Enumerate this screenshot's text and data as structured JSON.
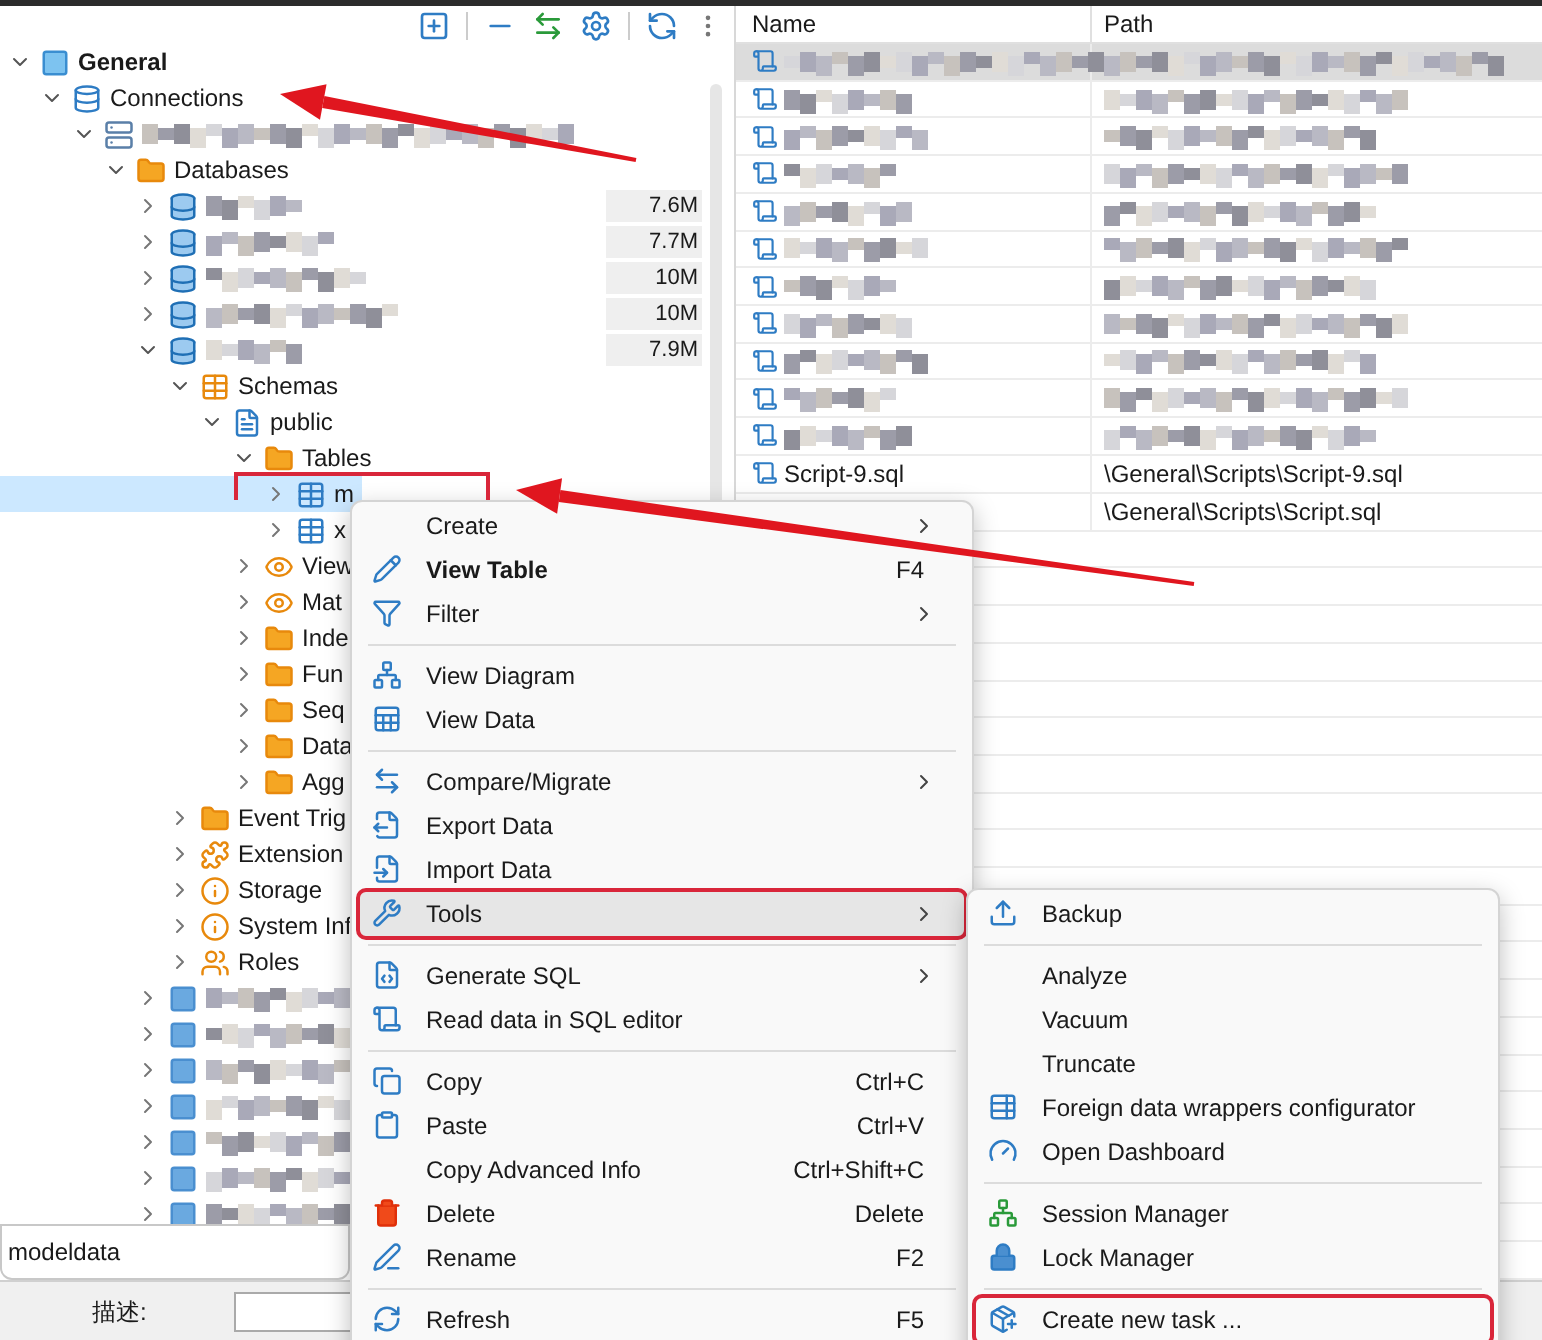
{
  "navigator": {
    "tree": [
      {
        "label": "General",
        "kind": "project",
        "expanded": true,
        "selected": false,
        "children": [
          {
            "label": "Connections",
            "kind": "connections",
            "expanded": true,
            "selected": false,
            "children": [
              {
                "kind": "connection",
                "expanded": true,
                "selected": false,
                "children": [
                  {
                    "label": "Databases",
                    "kind": "folder",
                    "expanded": true,
                    "selected": false,
                    "children": [
                      {
                        "kind": "database",
                        "expanded": false,
                        "selected": false,
                        "size": "7.6M"
                      },
                      {
                        "kind": "database",
                        "expanded": false,
                        "selected": false,
                        "size": "7.7M"
                      },
                      {
                        "kind": "database",
                        "expanded": false,
                        "selected": false,
                        "size": "10M"
                      },
                      {
                        "kind": "database",
                        "expanded": false,
                        "selected": false,
                        "size": "10M"
                      },
                      {
                        "kind": "database",
                        "expanded": true,
                        "selected": false,
                        "size": "7.9M",
                        "children": [
                          {
                            "label": "Schemas",
                            "kind": "schemas",
                            "expanded": true,
                            "selected": false,
                            "children": [
                              {
                                "label": "public",
                                "kind": "schema",
                                "expanded": true,
                                "selected": false,
                                "children": [
                                  {
                                    "label": "Tables",
                                    "kind": "folder",
                                    "expanded": true,
                                    "selected": false,
                                    "children": [
                                      {
                                        "label": "m",
                                        "kind": "table",
                                        "expanded": false,
                                        "selected": true
                                      },
                                      {
                                        "label": "x",
                                        "kind": "table",
                                        "expanded": false,
                                        "selected": false
                                      }
                                    ]
                                  },
                                  {
                                    "label": "View",
                                    "kind": "view",
                                    "expanded": false,
                                    "selected": false
                                  },
                                  {
                                    "label": "Mat",
                                    "kind": "view",
                                    "expanded": false,
                                    "selected": false
                                  },
                                  {
                                    "label": "Inde",
                                    "kind": "folder",
                                    "expanded": false,
                                    "selected": false
                                  },
                                  {
                                    "label": "Fun",
                                    "kind": "folder",
                                    "expanded": false,
                                    "selected": false
                                  },
                                  {
                                    "label": "Seq",
                                    "kind": "folder",
                                    "expanded": false,
                                    "selected": false
                                  },
                                  {
                                    "label": "Data",
                                    "kind": "folder",
                                    "expanded": false,
                                    "selected": false
                                  },
                                  {
                                    "label": "Agg",
                                    "kind": "folder",
                                    "expanded": false,
                                    "selected": false
                                  }
                                ]
                              }
                            ]
                          },
                          {
                            "label": "Event Trig",
                            "kind": "folder",
                            "expanded": false,
                            "selected": false
                          },
                          {
                            "label": "Extension",
                            "kind": "extensions",
                            "expanded": false,
                            "selected": false
                          },
                          {
                            "label": "Storage",
                            "kind": "info",
                            "expanded": false,
                            "selected": false
                          },
                          {
                            "label": "System Inf",
                            "kind": "info",
                            "expanded": false,
                            "selected": false
                          },
                          {
                            "label": "Roles",
                            "kind": "roles",
                            "expanded": false,
                            "selected": false
                          }
                        ]
                      },
                      {
                        "kind": "other",
                        "expanded": false,
                        "selected": false
                      },
                      {
                        "kind": "other",
                        "expanded": false,
                        "selected": false
                      },
                      {
                        "kind": "other",
                        "expanded": false,
                        "selected": false
                      },
                      {
                        "kind": "other",
                        "expanded": false,
                        "selected": false
                      },
                      {
                        "kind": "other",
                        "expanded": false,
                        "selected": false
                      },
                      {
                        "kind": "other",
                        "expanded": false,
                        "selected": false
                      },
                      {
                        "kind": "other",
                        "expanded": false,
                        "selected": false
                      }
                    ]
                  }
                ]
              }
            ]
          }
        ]
      }
    ],
    "tooltip": "modeldata",
    "description_label": "描述:"
  },
  "scripts_table": {
    "columns": [
      "Name",
      "Path"
    ],
    "rows": [
      {
        "selected": true
      },
      {
        "selected": false
      },
      {
        "selected": false
      },
      {
        "selected": false
      },
      {
        "selected": false
      },
      {
        "selected": false
      },
      {
        "selected": false
      },
      {
        "selected": false
      },
      {
        "selected": false
      },
      {
        "selected": false
      },
      {
        "selected": false
      },
      {
        "name": "Script-9.sql",
        "path": "\\General\\Scripts\\Script-9.sql",
        "selected": false
      },
      {
        "path": "\\General\\Scripts\\Script.sql",
        "selected": false
      }
    ]
  },
  "context_menu": {
    "items": [
      {
        "kind": "item",
        "label": "Create",
        "default": false,
        "submenu": true,
        "selected": false
      },
      {
        "kind": "item",
        "label": "View Table",
        "shortcut": "F4",
        "default": true,
        "submenu": false,
        "selected": false
      },
      {
        "kind": "item",
        "label": "Filter",
        "default": false,
        "submenu": true,
        "selected": false
      },
      {
        "kind": "separator"
      },
      {
        "kind": "item",
        "label": "View Diagram",
        "default": false,
        "submenu": false,
        "selected": false
      },
      {
        "kind": "item",
        "label": "View Data",
        "default": false,
        "submenu": false,
        "selected": false
      },
      {
        "kind": "separator"
      },
      {
        "kind": "item",
        "label": "Compare/Migrate",
        "default": false,
        "submenu": true,
        "selected": false
      },
      {
        "kind": "item",
        "label": "Export Data",
        "default": false,
        "submenu": false,
        "selected": false
      },
      {
        "kind": "item",
        "label": "Import Data",
        "default": false,
        "submenu": false,
        "selected": false
      },
      {
        "kind": "item",
        "label": "Tools",
        "default": false,
        "submenu": true,
        "selected": true
      },
      {
        "kind": "separator"
      },
      {
        "kind": "item",
        "label": "Generate SQL",
        "default": false,
        "submenu": true,
        "selected": false
      },
      {
        "kind": "item",
        "label": "Read data in SQL editor",
        "default": false,
        "submenu": false,
        "selected": false
      },
      {
        "kind": "separator"
      },
      {
        "kind": "item",
        "label": "Copy",
        "shortcut": "Ctrl+C",
        "default": false,
        "submenu": false,
        "selected": false
      },
      {
        "kind": "item",
        "label": "Paste",
        "shortcut": "Ctrl+V",
        "default": false,
        "submenu": false,
        "selected": false
      },
      {
        "kind": "item",
        "label": "Copy Advanced Info",
        "shortcut": "Ctrl+Shift+C",
        "default": false,
        "submenu": false,
        "selected": false
      },
      {
        "kind": "item",
        "label": "Delete",
        "shortcut": "Delete",
        "default": false,
        "submenu": false,
        "selected": false
      },
      {
        "kind": "item",
        "label": "Rename",
        "shortcut": "F2",
        "default": false,
        "submenu": false,
        "selected": false
      },
      {
        "kind": "separator"
      },
      {
        "kind": "item",
        "label": "Refresh",
        "shortcut": "F5",
        "default": false,
        "submenu": false,
        "selected": false
      }
    ]
  },
  "tools_submenu": {
    "items": [
      {
        "kind": "item",
        "label": "Backup",
        "selected": false
      },
      {
        "kind": "separator"
      },
      {
        "kind": "item",
        "label": "Analyze",
        "selected": false
      },
      {
        "kind": "item",
        "label": "Vacuum",
        "selected": false
      },
      {
        "kind": "item",
        "label": "Truncate",
        "selected": false
      },
      {
        "kind": "item",
        "label": "Foreign data wrappers configurator",
        "selected": false
      },
      {
        "kind": "item",
        "label": "Open Dashboard",
        "selected": false
      },
      {
        "kind": "separator"
      },
      {
        "kind": "item",
        "label": "Session Manager",
        "selected": false
      },
      {
        "kind": "item",
        "label": "Lock Manager",
        "selected": false
      },
      {
        "kind": "separator"
      },
      {
        "kind": "item",
        "label": "Create new task ...",
        "selected": false
      }
    ]
  }
}
